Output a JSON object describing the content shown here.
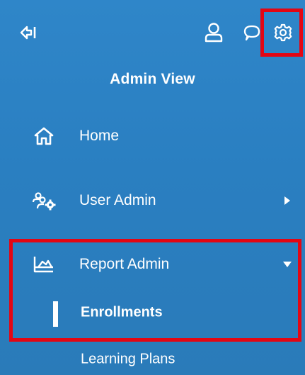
{
  "header": {
    "title": "Admin View",
    "icons": {
      "collapse": "collapse-sidebar-icon",
      "profile": "user-profile-icon",
      "chat": "chat-bubble-icon",
      "settings": "gear-icon"
    }
  },
  "nav": {
    "items": [
      {
        "label": "Home",
        "icon": "home-icon"
      },
      {
        "label": "User Admin",
        "icon": "user-admin-icon",
        "arrow": "caret-right"
      },
      {
        "label": "Report Admin",
        "icon": "report-chart-icon",
        "arrow": "caret-down",
        "expanded": true
      }
    ],
    "report_subitems": [
      {
        "label": "Enrollments",
        "active": true
      },
      {
        "label": "Learning Plans",
        "active": false
      }
    ]
  },
  "colors": {
    "panel_background": "#2a7fc1",
    "text": "#ffffff",
    "highlight_border": "#e30613"
  }
}
